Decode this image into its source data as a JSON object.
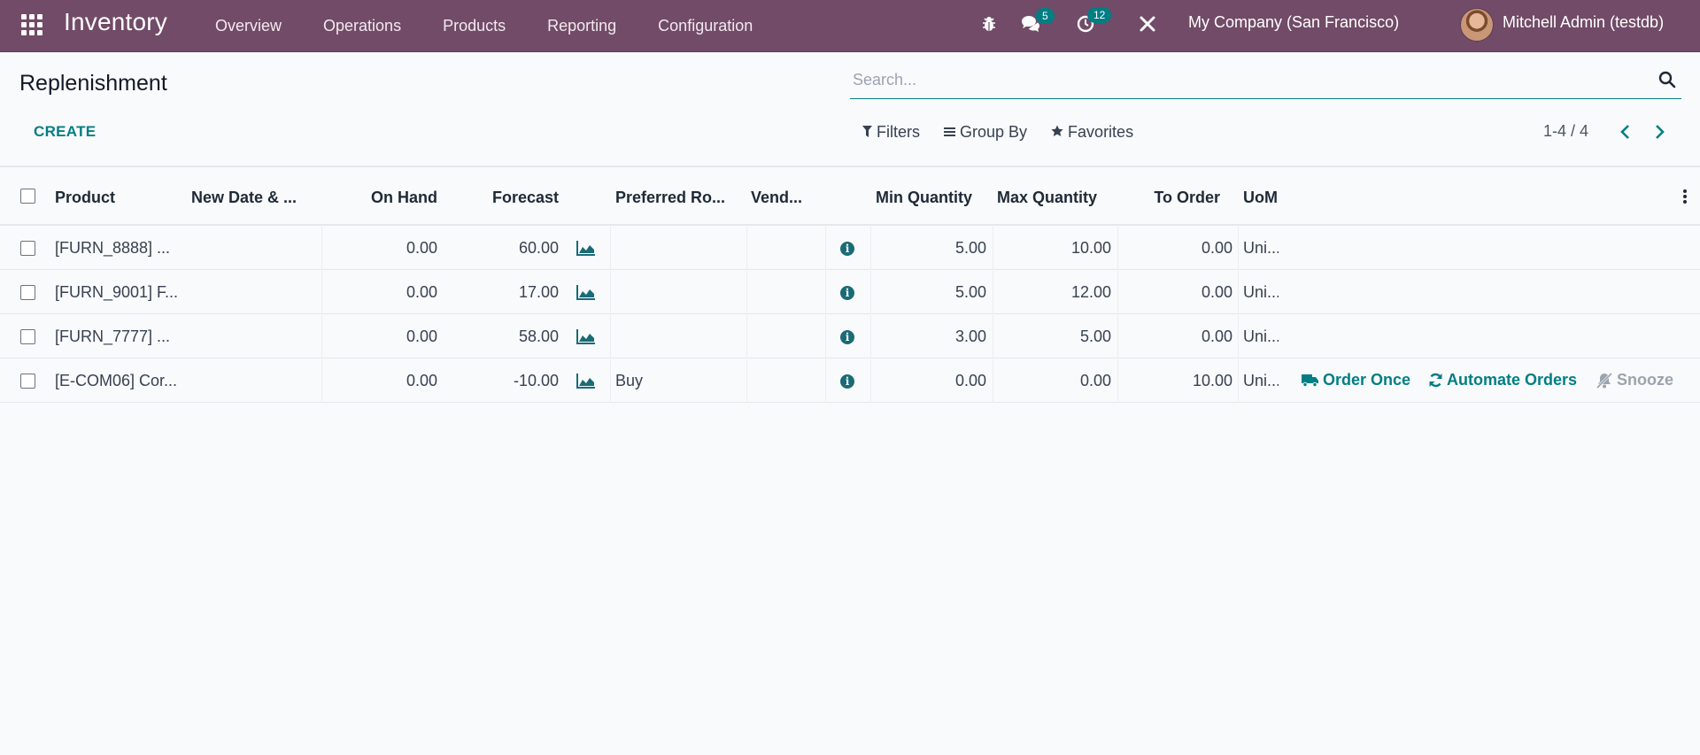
{
  "navbar": {
    "app_title": "Inventory",
    "menu": [
      "Overview",
      "Operations",
      "Products",
      "Reporting",
      "Configuration"
    ],
    "messages_count": "5",
    "activities_count": "12",
    "company": "My Company (San Francisco)",
    "user": "Mitchell Admin (testdb)",
    "icons": [
      "apps-grid-icon",
      "bug-icon",
      "chat-icon",
      "clock-icon",
      "tools-icon"
    ]
  },
  "control_panel": {
    "title": "Replenishment",
    "search_placeholder": "Search...",
    "create_label": "CREATE",
    "filters_label": "Filters",
    "group_by_label": "Group By",
    "favorites_label": "Favorites",
    "pager": "1-4 / 4"
  },
  "table": {
    "columns": {
      "product": "Product",
      "new_date": "New Date & ...",
      "on_hand": "On Hand",
      "forecast": "Forecast",
      "preferred_route": "Preferred Ro...",
      "vendor": "Vend...",
      "min_qty": "Min Quantity",
      "max_qty": "Max Quantity",
      "to_order": "To Order",
      "uom": "UoM"
    },
    "rows": [
      {
        "product": "[FURN_8888] ...",
        "new_date": "",
        "on_hand": "0.00",
        "forecast": "60.00",
        "route": "",
        "vendor": "",
        "min_qty": "5.00",
        "max_qty": "10.00",
        "to_order": "0.00",
        "uom": "Uni..."
      },
      {
        "product": "[FURN_9001] F...",
        "new_date": "",
        "on_hand": "0.00",
        "forecast": "17.00",
        "route": "",
        "vendor": "",
        "min_qty": "5.00",
        "max_qty": "12.00",
        "to_order": "0.00",
        "uom": "Uni..."
      },
      {
        "product": "[FURN_7777] ...",
        "new_date": "",
        "on_hand": "0.00",
        "forecast": "58.00",
        "route": "",
        "vendor": "",
        "min_qty": "3.00",
        "max_qty": "5.00",
        "to_order": "0.00",
        "uom": "Uni..."
      },
      {
        "product": "[E-COM06] Cor...",
        "new_date": "",
        "on_hand": "0.00",
        "forecast": "-10.00",
        "route": "Buy",
        "vendor": "",
        "min_qty": "0.00",
        "max_qty": "0.00",
        "to_order": "10.00",
        "uom": "Uni..."
      }
    ],
    "row_actions": {
      "order_once": "Order Once",
      "automate_orders": "Automate Orders",
      "snooze": "Snooze"
    }
  },
  "colors": {
    "navbar": "#714b67",
    "accent": "#017e84",
    "background": "#f9fafb"
  }
}
